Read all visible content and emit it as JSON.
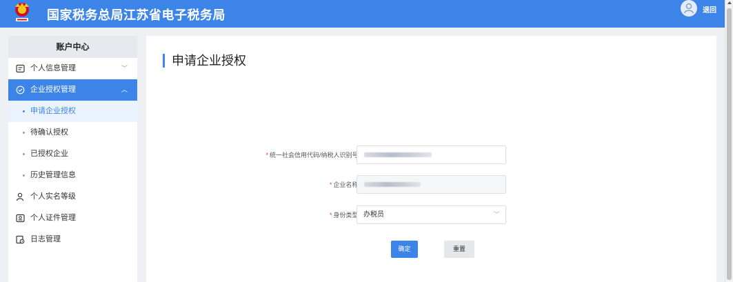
{
  "header": {
    "title": "国家税务总局江苏省电子税务局",
    "logout_label": "退回",
    "brand_color": "#3c84e8"
  },
  "sidebar": {
    "title": "账户中心",
    "items": [
      {
        "label": "个人信息管理",
        "icon": "person-info-icon",
        "expanded": false
      },
      {
        "label": "企业授权管理",
        "icon": "shield-check-icon",
        "expanded": true,
        "children": [
          {
            "label": "申请企业授权",
            "current": true
          },
          {
            "label": "待确认授权"
          },
          {
            "label": "已授权企业"
          },
          {
            "label": "历史管理信息"
          }
        ]
      },
      {
        "label": "个人实名等级",
        "icon": "user-level-icon"
      },
      {
        "label": "个人证件管理",
        "icon": "id-card-icon"
      },
      {
        "label": "日志管理",
        "icon": "log-icon"
      }
    ]
  },
  "main": {
    "page_title": "申请企业授权",
    "form": {
      "credit_code_label": "统一社会信用代码/纳税人识别号:",
      "company_name_label": "企业名称:",
      "identity_type_label": "身份类型:",
      "identity_type_value": "办税员",
      "required_mark": "*"
    },
    "confirm_label": "确定",
    "reset_label": "重置"
  }
}
